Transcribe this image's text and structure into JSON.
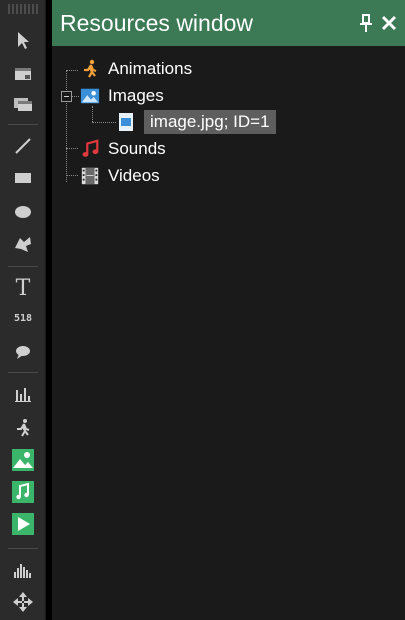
{
  "window": {
    "title": "Resources window",
    "pin_icon": "pin-icon",
    "close_icon": "close-icon",
    "title_bg": "#3c7a55"
  },
  "tree": {
    "animations": {
      "label": "Animations",
      "icon": "running-figure-icon"
    },
    "images": {
      "label": "Images",
      "icon": "image-folder-icon",
      "expanded": true,
      "children": [
        {
          "label": "image.jpg; ID=1",
          "icon": "image-file-icon",
          "selected": true
        }
      ]
    },
    "sounds": {
      "label": "Sounds",
      "icon": "music-note-icon"
    },
    "videos": {
      "label": "Videos",
      "icon": "film-icon"
    }
  },
  "toolbar": {
    "tools": [
      "select-arrow-icon",
      "window-icon",
      "stacked-windows-icon",
      "line-icon",
      "rectangle-icon",
      "ellipse-icon",
      "polygon-icon",
      "text-icon",
      "counter-icon",
      "speech-bubble-icon",
      "bar-chart-icon",
      "running-figure-icon",
      "image-icon",
      "sound-icon",
      "play-icon",
      "equalizer-icon",
      "move-icon"
    ],
    "text_tool_glyph": "T",
    "counter_glyph": "518"
  }
}
